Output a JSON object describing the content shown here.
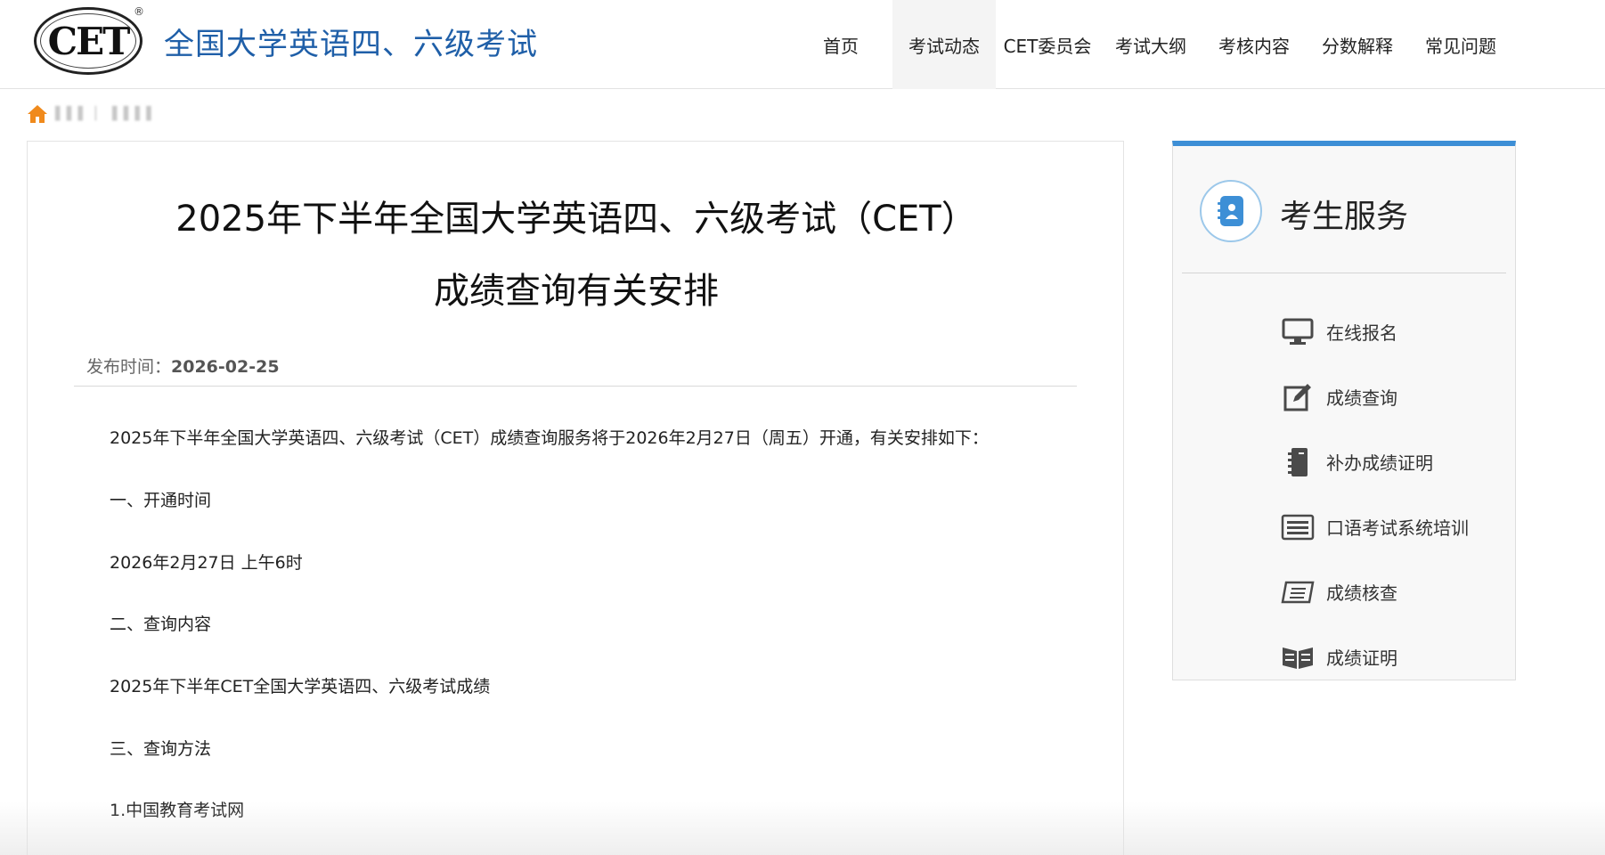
{
  "header": {
    "logo_text": "CET",
    "logo_reg": "®",
    "site_title": "全国大学英语四、六级考试",
    "nav": [
      {
        "label": "首页"
      },
      {
        "label": "考试动态"
      },
      {
        "label": "CET委员会"
      },
      {
        "label": "考试大纲"
      },
      {
        "label": "考核内容"
      },
      {
        "label": "分数解释"
      },
      {
        "label": "常见问题"
      }
    ]
  },
  "breadcrumb": {
    "icon": "home-icon",
    "text": "▌▌▌ ▏   ▌▌▌▌"
  },
  "article": {
    "title_line1": "2025年下半年全国大学英语四、六级考试（CET）",
    "title_line2": "成绩查询有关安排",
    "publish_label": "发布时间：",
    "publish_date": "2026-02-25",
    "paragraphs": [
      "2025年下半年全国大学英语四、六级考试（CET）成绩查询服务将于2026年2月27日（周五）开通，有关安排如下：",
      "一、开通时间",
      "2026年2月27日 上午6时",
      "二、查询内容",
      "2025年下半年CET全国大学英语四、六级考试成绩",
      "三、查询方法",
      "1.中国教育考试网"
    ]
  },
  "sidebar": {
    "title": "考生服务",
    "title_icon": "contact-book-icon",
    "accent_color": "#3d8fd6",
    "items": [
      {
        "label": "在线报名",
        "icon": "monitor-icon"
      },
      {
        "label": "成绩查询",
        "icon": "edit-icon"
      },
      {
        "label": "补办成绩证明",
        "icon": "notebook-icon"
      },
      {
        "label": "口语考试系统培训",
        "icon": "keyboard-icon"
      },
      {
        "label": "成绩核查",
        "icon": "document-icon"
      },
      {
        "label": "成绩证明",
        "icon": "book-icon"
      }
    ]
  }
}
